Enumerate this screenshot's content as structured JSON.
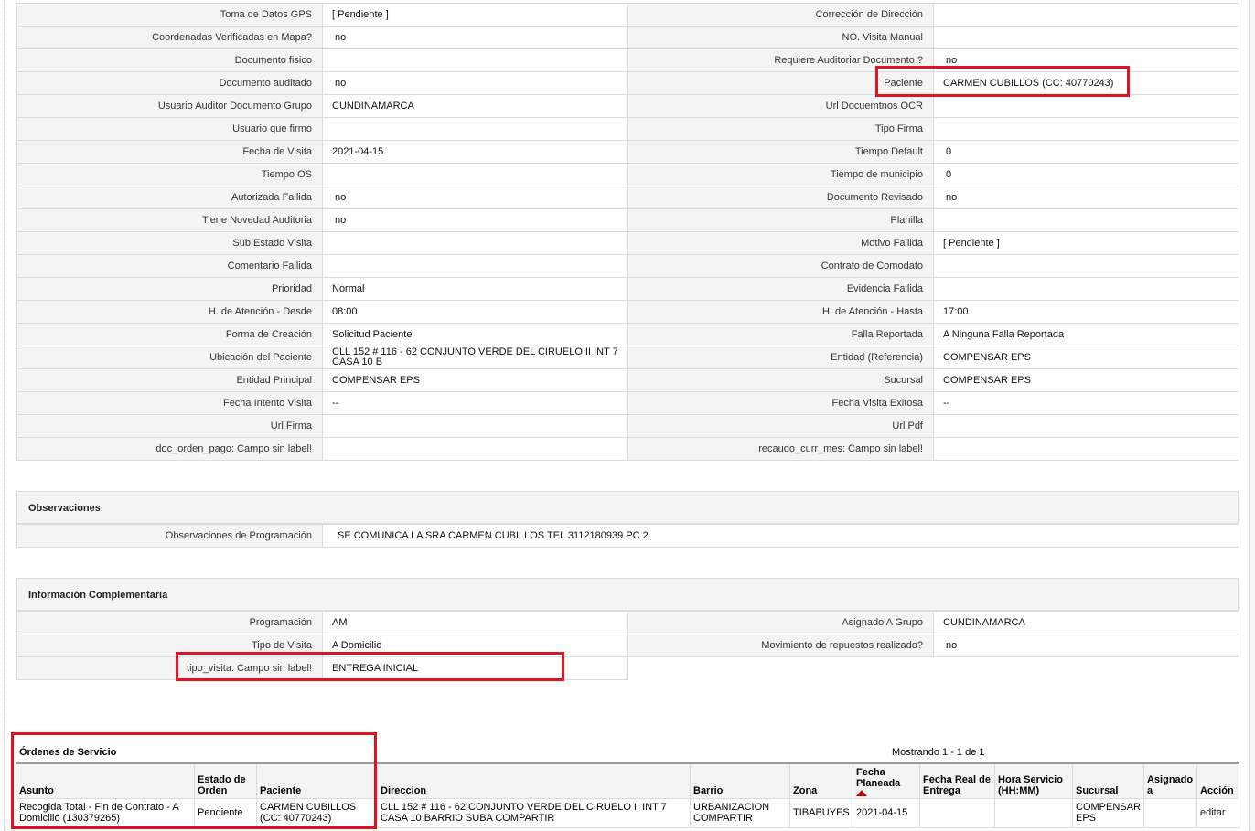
{
  "details": {
    "rows": [
      {
        "l1": "Toma de Datos GPS",
        "v1": "[ Pendiente ]",
        "l2": "Corrección de Dirección",
        "v2": ""
      },
      {
        "l1": "Coordenadas Verificadas en Mapa?",
        "v1": "no",
        "l2": "NO. Visita Manual",
        "v2": ""
      },
      {
        "l1": "Documento fisico",
        "v1": "",
        "l2": "Requiere Auditoriar Documento ?",
        "v2": "no"
      },
      {
        "l1": "Documento auditado",
        "v1": "no",
        "l2": "Paciente",
        "v2": "CARMEN CUBILLOS (CC: 40770243)"
      },
      {
        "l1": "Usuario Auditor Documento Grupo",
        "v1": "CUNDINAMARCA",
        "l2": "Url Docuemtnos OCR",
        "v2": ""
      },
      {
        "l1": "Usuario que firmo",
        "v1": "",
        "l2": "Tipo Firma",
        "v2": ""
      },
      {
        "l1": "Fecha de Visita",
        "v1": "2021-04-15",
        "l2": "Tiempo Default",
        "v2": "0"
      },
      {
        "l1": "Tiempo OS",
        "v1": "",
        "l2": "Tiempo de municipio",
        "v2": "0"
      },
      {
        "l1": "Autorizada Fallida",
        "v1": "no",
        "l2": "Documento Revisado",
        "v2": "no"
      },
      {
        "l1": "Tiene Novedad Auditoria",
        "v1": "no",
        "l2": "Planilla",
        "v2": ""
      },
      {
        "l1": "Sub Estado Visita",
        "v1": "",
        "l2": "Motivo Fallida",
        "v2": "[ Pendiente ]"
      },
      {
        "l1": "Comentario Fallida",
        "v1": "",
        "l2": "Contrato de Comodato",
        "v2": ""
      },
      {
        "l1": "Prioridad",
        "v1": "Normal",
        "l2": "Evidencia Fallida",
        "v2": ""
      },
      {
        "l1": "H. de Atención - Desde",
        "v1": "08:00",
        "l2": "H. de Atención - Hasta",
        "v2": "17:00"
      },
      {
        "l1": "Forma de Creación",
        "v1": "Solicitud Paciente",
        "l2": "Falla Reportada",
        "v2": "A Ninguna Falla Reportada"
      },
      {
        "l1": "Ubicación del Paciente",
        "v1": "CLL 152 # 116 - 62 CONJUNTO VERDE DEL CIRUELO II INT 7 CASA 10 B",
        "l2": "Entidad (Referencia)",
        "v2": "COMPENSAR EPS"
      },
      {
        "l1": "Entidad Principal",
        "v1": "COMPENSAR EPS",
        "l2": "Sucursal",
        "v2": "COMPENSAR EPS"
      },
      {
        "l1": "Fecha Intento Visita",
        "v1": "--",
        "l2": "Fecha Visita Exitosa",
        "v2": "--"
      },
      {
        "l1": "Url Firma",
        "v1": "",
        "l2": "Url Pdf",
        "v2": ""
      },
      {
        "l1": "doc_orden_pago: Campo sin label!",
        "v1": "",
        "l2": "recaudo_curr_mes: Campo sin label!",
        "v2": ""
      }
    ]
  },
  "observaciones": {
    "title": "Observaciones",
    "label": "Observaciones de Programación",
    "value": "SE COMUNICA LA SRA CARMEN CUBILLOS TEL 3112180939 PC 2"
  },
  "complementaria": {
    "title": "Información Complementaria",
    "programacion_label": "Programación",
    "programacion_value": "AM",
    "grupo_label": "Asignado A Grupo",
    "grupo_value": "CUNDINAMARCA",
    "tipo_label": "Tipo de Visita",
    "tipo_value": "A Domicilio",
    "repuestos_label": "Movimiento de repuestos realizado?",
    "repuestos_value": "no",
    "tipo_visita_label": "tipo_visita: Campo sin label!",
    "tipo_visita_value": "ENTREGA INICIAL"
  },
  "ordenes": {
    "title": "Órdenes de Servicio",
    "count": "Mostrando 1 - 1 de 1",
    "columns": [
      "Asunto",
      "Estado de Orden",
      "Paciente",
      "Direccion",
      "Barrio",
      "Zona",
      "Fecha Planeada",
      "Fecha Real de Entrega",
      "Hora Servicio (HH:MM)",
      "Sucursal",
      "Asignado a",
      "Acción"
    ],
    "row": {
      "asunto": "Recogida Total - Fin de Contrato - A Domicilio (130379265)",
      "estado": "Pendiente",
      "paciente": "CARMEN CUBILLOS (CC: 40770243)",
      "direccion": "CLL 152 # 116 - 62 CONJUNTO VERDE DEL CIRUELO II INT 7 CASA 10 BARRIO SUBA COMPARTIR",
      "barrio": "URBANIZACION COMPARTIR",
      "zona": "TIBABUYES",
      "fecha_planeada": "2021-04-15",
      "fecha_real": "",
      "hora_servicio": "",
      "sucursal": "COMPENSAR EPS",
      "asignado": "",
      "accion": "editar"
    }
  },
  "colors": {
    "highlight": "#e0141e",
    "label_bg": "#f4f4f4",
    "border": "#dcdcdc"
  }
}
